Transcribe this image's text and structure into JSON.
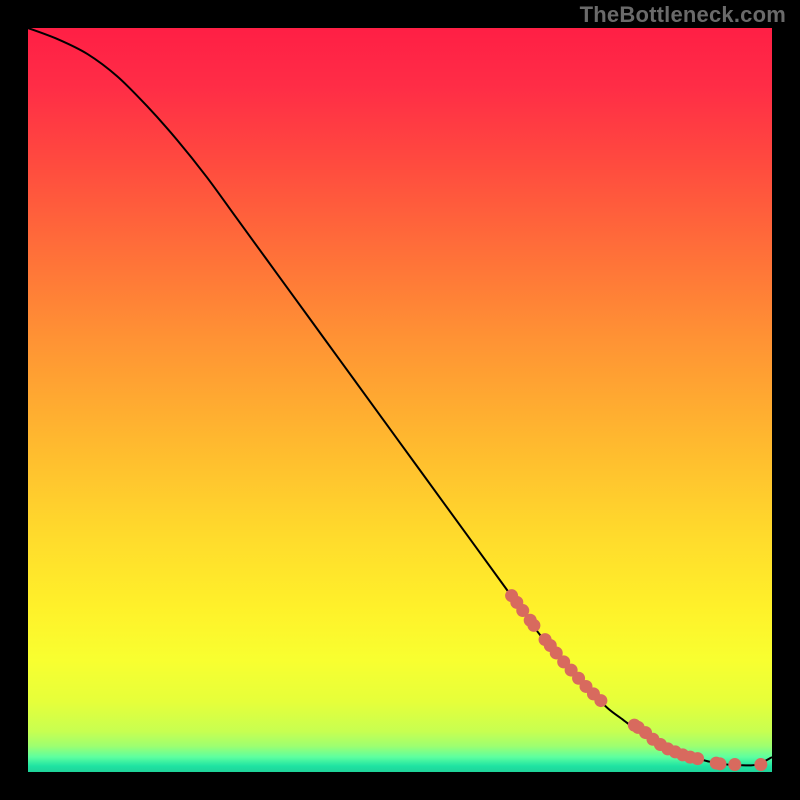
{
  "branding": {
    "watermark": "TheBottleneck.com"
  },
  "colors": {
    "background": "#000000",
    "curve": "#000000",
    "curve_alt": "#222222",
    "marker_fill": "#d86a5e",
    "marker_stroke": "#b34d44",
    "gradient_stops": [
      {
        "offset": 0.0,
        "color": "#ff1f45"
      },
      {
        "offset": 0.08,
        "color": "#ff2d46"
      },
      {
        "offset": 0.18,
        "color": "#ff4a3f"
      },
      {
        "offset": 0.3,
        "color": "#ff6f39"
      },
      {
        "offset": 0.42,
        "color": "#ff9334"
      },
      {
        "offset": 0.55,
        "color": "#ffb72f"
      },
      {
        "offset": 0.68,
        "color": "#ffda2c"
      },
      {
        "offset": 0.78,
        "color": "#fff12a"
      },
      {
        "offset": 0.85,
        "color": "#f8ff30"
      },
      {
        "offset": 0.905,
        "color": "#e6ff3a"
      },
      {
        "offset": 0.945,
        "color": "#c8ff50"
      },
      {
        "offset": 0.965,
        "color": "#9eff70"
      },
      {
        "offset": 0.98,
        "color": "#5cffa0"
      },
      {
        "offset": 0.992,
        "color": "#1fe3a2"
      },
      {
        "offset": 1.0,
        "color": "#1fd39a"
      }
    ]
  },
  "chart_data": {
    "type": "line",
    "title": "",
    "xlabel": "",
    "ylabel": "",
    "xlim": [
      0,
      100
    ],
    "ylim": [
      0,
      100
    ],
    "grid": false,
    "legend": false,
    "series": [
      {
        "name": "bottleneck-curve",
        "x": [
          0,
          4,
          8,
          12,
          16,
          20,
          24,
          28,
          32,
          36,
          40,
          44,
          48,
          52,
          56,
          60,
          64,
          68,
          72,
          76,
          78,
          80,
          82,
          84,
          86,
          88,
          90,
          92,
          94,
          96,
          98,
          100
        ],
        "y": [
          100,
          98.5,
          96.5,
          93.5,
          89.5,
          85.0,
          80.0,
          74.5,
          69.0,
          63.5,
          58.0,
          52.5,
          47.0,
          41.5,
          36.0,
          30.5,
          25.0,
          19.5,
          14.5,
          10.5,
          8.5,
          7.0,
          5.5,
          4.2,
          3.2,
          2.4,
          1.8,
          1.3,
          1.0,
          0.9,
          1.0,
          2.0
        ]
      }
    ],
    "markers": {
      "name": "highlighted-points",
      "x": [
        65.0,
        65.7,
        66.5,
        67.5,
        68.0,
        69.5,
        70.2,
        71.0,
        72.0,
        73.0,
        74.0,
        75.0,
        76.0,
        77.0,
        81.5,
        82.0,
        83.0,
        84.0,
        85.0,
        86.0,
        87.0,
        88.0,
        89.0,
        90.0,
        92.5,
        93.0,
        95.0,
        98.5
      ],
      "y": [
        23.7,
        22.8,
        21.7,
        20.4,
        19.7,
        17.8,
        17.0,
        16.0,
        14.8,
        13.7,
        12.6,
        11.5,
        10.5,
        9.6,
        6.3,
        6.0,
        5.3,
        4.4,
        3.7,
        3.1,
        2.7,
        2.3,
        2.0,
        1.8,
        1.2,
        1.1,
        1.0,
        1.0
      ]
    }
  }
}
